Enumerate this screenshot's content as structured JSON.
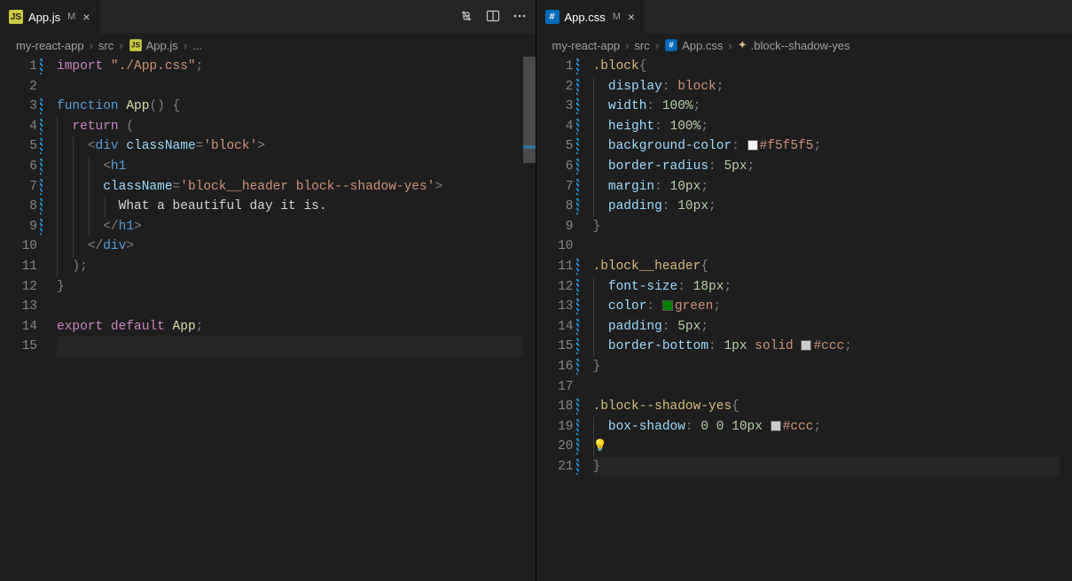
{
  "left": {
    "tab": {
      "filename": "App.js",
      "modified_letter": "M"
    },
    "breadcrumb": [
      "my-react-app",
      "src",
      "App.js",
      "..."
    ],
    "toolbar": {
      "compare": "compare-changes-icon",
      "split": "split-editor-icon",
      "more": "more-actions-icon"
    },
    "code": {
      "lines": [
        {
          "n": 1,
          "mod": true,
          "tokens": [
            [
              "kw2",
              "import"
            ],
            [
              "txt",
              " "
            ],
            [
              "str",
              "\"./App.css\""
            ],
            [
              "punc",
              ";"
            ]
          ]
        },
        {
          "n": 2,
          "mod": false,
          "tokens": []
        },
        {
          "n": 3,
          "mod": true,
          "tokens": [
            [
              "kw",
              "function"
            ],
            [
              "txt",
              " "
            ],
            [
              "fn",
              "App"
            ],
            [
              "punc",
              "() {"
            ]
          ]
        },
        {
          "n": 4,
          "mod": true,
          "indent": 1,
          "tokens": [
            [
              "kw2",
              "return"
            ],
            [
              "txt",
              " "
            ],
            [
              "punc",
              "("
            ]
          ]
        },
        {
          "n": 5,
          "mod": true,
          "indent": 2,
          "tokens": [
            [
              "punc",
              "<"
            ],
            [
              "tag",
              "div"
            ],
            [
              "txt",
              " "
            ],
            [
              "attr",
              "className"
            ],
            [
              "punc",
              "="
            ],
            [
              "str",
              "'block'"
            ],
            [
              "punc",
              ">"
            ]
          ]
        },
        {
          "n": 6,
          "mod": true,
          "indent": 3,
          "tokens": [
            [
              "punc",
              "<"
            ],
            [
              "tag",
              "h1"
            ]
          ]
        },
        {
          "n": 7,
          "mod": true,
          "indent": 3,
          "tokens": [
            [
              "attr",
              "className"
            ],
            [
              "punc",
              "="
            ],
            [
              "str",
              "'block__header block--shadow-yes'"
            ],
            [
              "punc",
              ">"
            ]
          ]
        },
        {
          "n": 8,
          "mod": true,
          "indent": 4,
          "tokens": [
            [
              "txt",
              "What a beautiful day it is."
            ]
          ]
        },
        {
          "n": 9,
          "mod": true,
          "indent": 3,
          "tokens": [
            [
              "punc",
              "</"
            ],
            [
              "tag",
              "h1"
            ],
            [
              "punc",
              ">"
            ]
          ]
        },
        {
          "n": 10,
          "mod": false,
          "indent": 2,
          "tokens": [
            [
              "punc",
              "</"
            ],
            [
              "tag",
              "div"
            ],
            [
              "punc",
              ">"
            ]
          ]
        },
        {
          "n": 11,
          "mod": false,
          "indent": 1,
          "tokens": [
            [
              "punc",
              ");"
            ]
          ]
        },
        {
          "n": 12,
          "mod": false,
          "tokens": [
            [
              "punc",
              "}"
            ]
          ]
        },
        {
          "n": 13,
          "mod": false,
          "tokens": []
        },
        {
          "n": 14,
          "mod": false,
          "tokens": [
            [
              "kw2",
              "export"
            ],
            [
              "txt",
              " "
            ],
            [
              "kw2",
              "default"
            ],
            [
              "txt",
              " "
            ],
            [
              "fn",
              "App"
            ],
            [
              "punc",
              ";"
            ]
          ]
        },
        {
          "n": 15,
          "mod": false,
          "cursor": true,
          "tokens": []
        }
      ]
    }
  },
  "right": {
    "tab": {
      "filename": "App.css",
      "modified_letter": "M"
    },
    "breadcrumb": [
      "my-react-app",
      "src",
      "App.css",
      ".block--shadow-yes"
    ],
    "code": {
      "lines": [
        {
          "n": 1,
          "mod": true,
          "tokens": [
            [
              "sel",
              ".block"
            ],
            [
              "punc",
              "{"
            ]
          ]
        },
        {
          "n": 2,
          "mod": true,
          "indent": 1,
          "tokens": [
            [
              "prop",
              "display"
            ],
            [
              "punc",
              ": "
            ],
            [
              "val",
              "block"
            ],
            [
              "punc",
              ";"
            ]
          ]
        },
        {
          "n": 3,
          "mod": true,
          "indent": 1,
          "tokens": [
            [
              "prop",
              "width"
            ],
            [
              "punc",
              ": "
            ],
            [
              "num",
              "100%"
            ],
            [
              "punc",
              ";"
            ]
          ]
        },
        {
          "n": 4,
          "mod": true,
          "indent": 1,
          "tokens": [
            [
              "prop",
              "height"
            ],
            [
              "punc",
              ": "
            ],
            [
              "num",
              "100%"
            ],
            [
              "punc",
              ";"
            ]
          ]
        },
        {
          "n": 5,
          "mod": true,
          "indent": 1,
          "swatch": "f5",
          "tokens": [
            [
              "prop",
              "background-color"
            ],
            [
              "punc",
              ": "
            ],
            [
              "val",
              "#f5f5f5"
            ],
            [
              "punc",
              ";"
            ]
          ]
        },
        {
          "n": 6,
          "mod": true,
          "indent": 1,
          "tokens": [
            [
              "prop",
              "border-radius"
            ],
            [
              "punc",
              ": "
            ],
            [
              "num",
              "5px"
            ],
            [
              "punc",
              ";"
            ]
          ]
        },
        {
          "n": 7,
          "mod": true,
          "indent": 1,
          "tokens": [
            [
              "prop",
              "margin"
            ],
            [
              "punc",
              ": "
            ],
            [
              "num",
              "10px"
            ],
            [
              "punc",
              ";"
            ]
          ]
        },
        {
          "n": 8,
          "mod": true,
          "indent": 1,
          "tokens": [
            [
              "prop",
              "padding"
            ],
            [
              "punc",
              ": "
            ],
            [
              "num",
              "10px"
            ],
            [
              "punc",
              ";"
            ]
          ]
        },
        {
          "n": 9,
          "mod": false,
          "tokens": [
            [
              "punc",
              "}"
            ]
          ]
        },
        {
          "n": 10,
          "mod": false,
          "tokens": []
        },
        {
          "n": 11,
          "mod": true,
          "tokens": [
            [
              "sel",
              ".block__header"
            ],
            [
              "punc",
              "{"
            ]
          ]
        },
        {
          "n": 12,
          "mod": true,
          "indent": 1,
          "tokens": [
            [
              "prop",
              "font-size"
            ],
            [
              "punc",
              ": "
            ],
            [
              "num",
              "18px"
            ],
            [
              "punc",
              ";"
            ]
          ]
        },
        {
          "n": 13,
          "mod": true,
          "indent": 1,
          "swatch": "green",
          "tokens": [
            [
              "prop",
              "color"
            ],
            [
              "punc",
              ": "
            ],
            [
              "val",
              "green"
            ],
            [
              "punc",
              ";"
            ]
          ]
        },
        {
          "n": 14,
          "mod": true,
          "indent": 1,
          "tokens": [
            [
              "prop",
              "padding"
            ],
            [
              "punc",
              ": "
            ],
            [
              "num",
              "5px"
            ],
            [
              "punc",
              ";"
            ]
          ]
        },
        {
          "n": 15,
          "mod": true,
          "indent": 1,
          "swatch": "ccc",
          "tokens": [
            [
              "prop",
              "border-bottom"
            ],
            [
              "punc",
              ": "
            ],
            [
              "num",
              "1px"
            ],
            [
              "txt",
              " "
            ],
            [
              "val",
              "solid"
            ],
            [
              "txt",
              " "
            ],
            [
              "val",
              "#ccc"
            ],
            [
              "punc",
              ";"
            ]
          ]
        },
        {
          "n": 16,
          "mod": true,
          "tokens": [
            [
              "punc",
              "}"
            ]
          ]
        },
        {
          "n": 17,
          "mod": false,
          "tokens": []
        },
        {
          "n": 18,
          "mod": true,
          "tokens": [
            [
              "sel",
              ".block--shadow-yes"
            ],
            [
              "punc",
              "{"
            ]
          ]
        },
        {
          "n": 19,
          "mod": true,
          "indent": 1,
          "swatch": "ccc",
          "tokens": [
            [
              "prop",
              "box-shadow"
            ],
            [
              "punc",
              ": "
            ],
            [
              "num",
              "0 0 10px"
            ],
            [
              "txt",
              " "
            ],
            [
              "val",
              "#ccc"
            ],
            [
              "punc",
              ";"
            ]
          ]
        },
        {
          "n": 20,
          "mod": true,
          "indent": 1,
          "bulb": true,
          "tokens": []
        },
        {
          "n": 21,
          "mod": true,
          "cursor": true,
          "tokens": [
            [
              "punc",
              "}"
            ]
          ]
        }
      ]
    }
  }
}
